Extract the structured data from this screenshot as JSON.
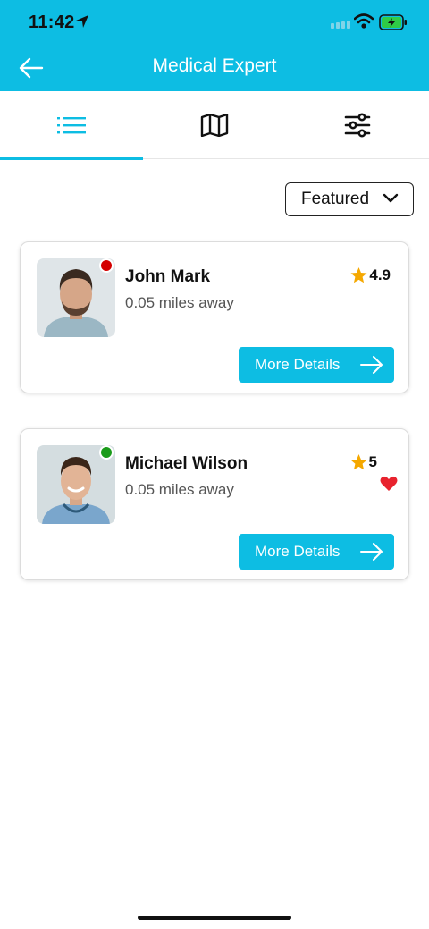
{
  "status_bar": {
    "time": "11:42"
  },
  "header": {
    "title": "Medical Expert"
  },
  "tabs": [
    {
      "name": "list",
      "icon": "list-icon",
      "active": true
    },
    {
      "name": "map",
      "icon": "map-icon",
      "active": false
    },
    {
      "name": "filters",
      "icon": "sliders-icon",
      "active": false
    }
  ],
  "sort": {
    "selected": "Featured"
  },
  "experts": [
    {
      "name": "John Mark",
      "distance": "0.05 miles away",
      "rating": "4.9",
      "online": false,
      "status_color": "#d40000",
      "favorite": false,
      "button_label": "More Details"
    },
    {
      "name": "Michael Wilson",
      "distance": "0.05 miles away",
      "rating": "5",
      "online": true,
      "status_color": "#1a9b1a",
      "favorite": true,
      "button_label": "More Details"
    }
  ],
  "colors": {
    "accent": "#0dbde3",
    "star": "#f5a800",
    "heart": "#e8232e"
  }
}
